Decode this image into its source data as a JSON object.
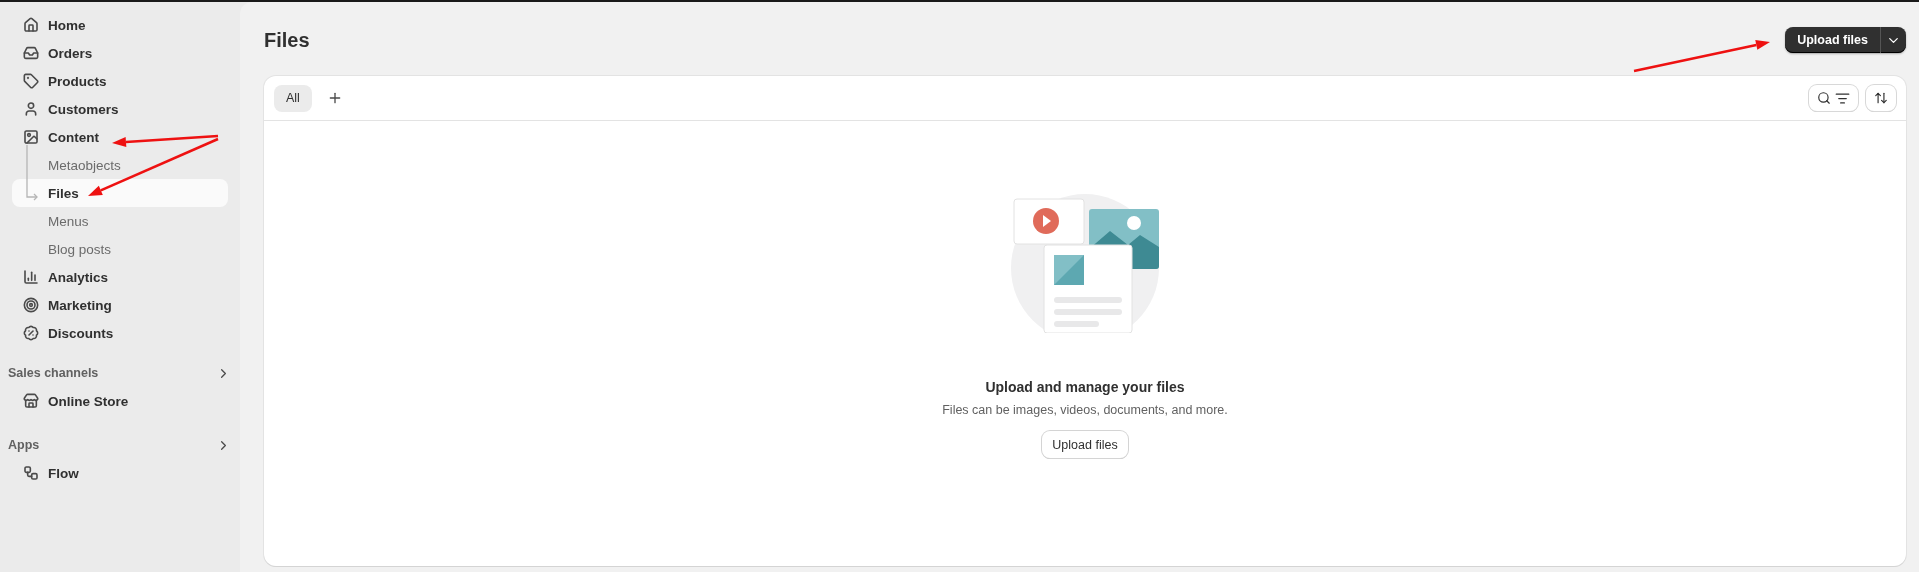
{
  "sidebar": {
    "nav": [
      {
        "label": "Home",
        "selected": false
      },
      {
        "label": "Orders",
        "selected": false
      },
      {
        "label": "Products",
        "selected": false
      },
      {
        "label": "Customers",
        "selected": false
      },
      {
        "label": "Content",
        "selected": false,
        "children": [
          {
            "label": "Metaobjects",
            "selected": false
          },
          {
            "label": "Files",
            "selected": true
          },
          {
            "label": "Menus",
            "selected": false
          },
          {
            "label": "Blog posts",
            "selected": false
          }
        ]
      },
      {
        "label": "Analytics",
        "selected": false
      },
      {
        "label": "Marketing",
        "selected": false
      },
      {
        "label": "Discounts",
        "selected": false
      }
    ],
    "sections": [
      {
        "title": "Sales channels",
        "items": [
          {
            "label": "Online Store",
            "selected": false
          }
        ]
      },
      {
        "title": "Apps",
        "items": [
          {
            "label": "Flow",
            "selected": false
          }
        ]
      }
    ]
  },
  "page": {
    "title": "Files",
    "primary_action": "Upload files"
  },
  "card": {
    "tabs": [
      {
        "label": "All",
        "selected": true
      }
    ],
    "empty_state": {
      "heading": "Upload and manage your files",
      "text": "Files can be images, videos, documents, and more.",
      "button": "Upload files"
    }
  }
}
